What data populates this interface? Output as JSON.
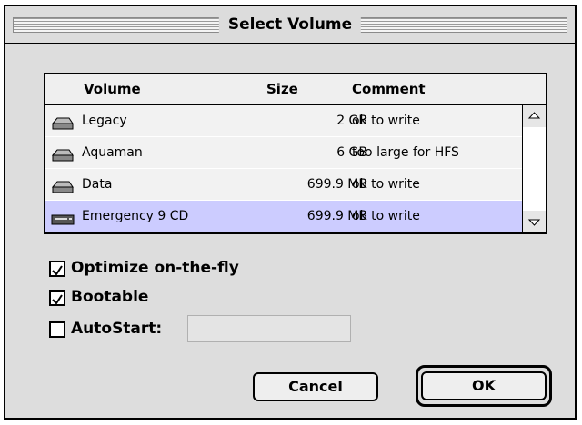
{
  "dialog": {
    "title": "Select Volume"
  },
  "volume_list": {
    "columns": [
      "Volume",
      "Size",
      "Comment"
    ],
    "rows": [
      {
        "icon": "hard-disk-icon",
        "volume": "Legacy",
        "size": "2 GB",
        "comment": "ok to write",
        "selected": false
      },
      {
        "icon": "hard-disk-icon",
        "volume": "Aquaman",
        "size": "6 GB",
        "comment": "too large for HFS",
        "selected": false
      },
      {
        "icon": "hard-disk-icon",
        "volume": "Data",
        "size": "699.9 MB",
        "comment": "ok to write",
        "selected": false
      },
      {
        "icon": "cd-drive-icon",
        "volume": "Emergency 9 CD",
        "size": "699.9 MB",
        "comment": "ok to write",
        "selected": true
      }
    ]
  },
  "options": {
    "optimize": {
      "label": "Optimize on-the-fly",
      "checked": true
    },
    "bootable": {
      "label": "Bootable",
      "checked": true
    },
    "autostart": {
      "label": "AutoStart:",
      "checked": false,
      "value": ""
    }
  },
  "buttons": {
    "cancel": "Cancel",
    "ok": "OK"
  },
  "colors": {
    "selection": "#ccccff",
    "window_background": "#dddddd"
  }
}
